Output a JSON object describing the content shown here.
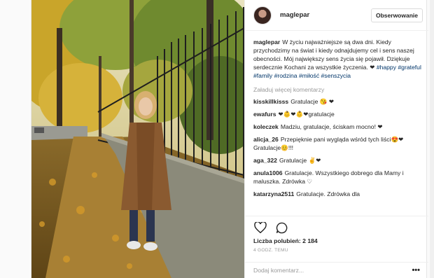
{
  "header": {
    "username": "maglepar",
    "follow_label": "Obserwowanie"
  },
  "caption": {
    "username": "maglepar",
    "text": "W życiu najważniejsze są dwa dni. Kiedy przychodzimy na świat i kiedy odnajdujemy cel i sens naszej obecności. Mój największy sens życia się pojawił. Dziękuje serdecznie Kochani za wszystkie życzenia. ❤",
    "hashtags": [
      "#happy",
      "#grateful",
      "#family",
      "#rodzina",
      "#miłość",
      "#senszycia"
    ]
  },
  "load_more_label": "Załaduj więcej komentarzy",
  "comments": [
    {
      "user": "kisskillkisss",
      "text": "Gratulacje 😘 ❤"
    },
    {
      "user": "ewafurs",
      "text": "❤👶❤👶❤gratulacje"
    },
    {
      "user": "koleczek",
      "text": "Madziu, gratulacje, ściskam mocno! ❤"
    },
    {
      "user": "alicja_26",
      "text": "Przepięknie pani wygląda wśród tych liści😍❤ Gratulacje😊!!!"
    },
    {
      "user": "aga_322",
      "text": "Gratulacje ✌❤"
    },
    {
      "user": "anula1006",
      "text": "Gratulacje. Wszystkiego dobrego dla Mamy i maluszka. Zdrówka ♡"
    },
    {
      "user": "katarzyna2511",
      "text": "Gratulacje. Zdrówka dla"
    }
  ],
  "likes_text": "Liczba polubień: 2 184",
  "time_text": "4 GODZ. TEMU",
  "add_comment_placeholder": "Dodaj komentarz...",
  "more_options": "•••",
  "icons": {
    "like": "heart-icon",
    "comment": "speech-bubble-icon"
  }
}
